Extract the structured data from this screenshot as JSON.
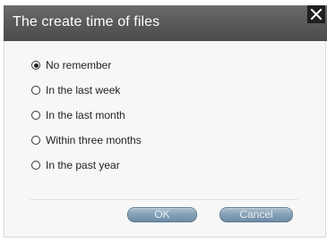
{
  "dialog": {
    "title": "The create time of files",
    "close_icon": "close-x-icon"
  },
  "options": [
    {
      "label": "No remember",
      "checked": true
    },
    {
      "label": "In the last week",
      "checked": false
    },
    {
      "label": "In the last month",
      "checked": false
    },
    {
      "label": "Within three months",
      "checked": false
    },
    {
      "label": "In the past year",
      "checked": false
    }
  ],
  "buttons": {
    "ok_label": "OK",
    "cancel_label": "Cancel"
  },
  "colors": {
    "titlebar": "#5a5a5a",
    "button_accent": "#86a2b8"
  }
}
